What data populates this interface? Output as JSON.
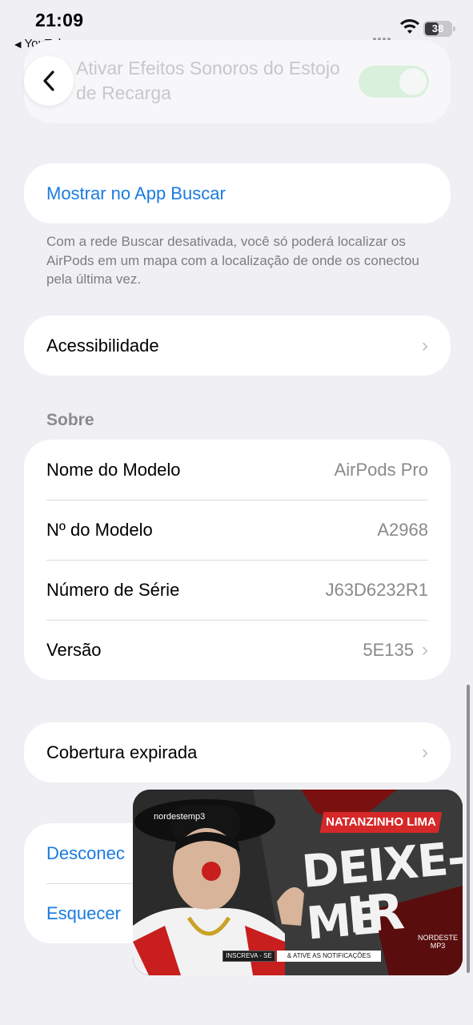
{
  "status_bar": {
    "time": "21:09",
    "back_app": "YouTube",
    "battery": "38",
    "colors": {
      "battery_bg": "#c7c7cc"
    }
  },
  "faded_row": {
    "label": "Ativar Efeitos Sonoros do Estojo de Recarga",
    "toggle_on": true
  },
  "find_my": {
    "label": "Mostrar no App Buscar",
    "footnote": "Com a rede Buscar desativada, você só poderá localizar os AirPods em um mapa com a localização de onde os conectou pela última vez."
  },
  "accessibility": {
    "label": "Acessibilidade"
  },
  "about": {
    "header": "Sobre",
    "rows": [
      {
        "label": "Nome do Modelo",
        "value": "AirPods Pro"
      },
      {
        "label": "Nº do Modelo",
        "value": "A2968"
      },
      {
        "label": "Número de Série",
        "value": "J63D6232R1"
      },
      {
        "label": "Versão",
        "value": "5E135"
      }
    ]
  },
  "coverage": {
    "label": "Cobertura expirada"
  },
  "actions": {
    "disconnect": "Desconec",
    "forget": "Esquecer"
  },
  "pip_video": {
    "instagram": "nordestemp3",
    "artist": "NATANZINHO LIMA",
    "title_line1": "DEIXE-ME",
    "title_line2": "IR",
    "subscribe": "INSCREVA - SE",
    "notify": "& ATIVE AS NOTIFICAÇÕES",
    "logo": "NORDESTE MP3"
  },
  "colors": {
    "accent": "#1a7be0",
    "background": "#efeff4",
    "brand_red": "#d62828"
  }
}
